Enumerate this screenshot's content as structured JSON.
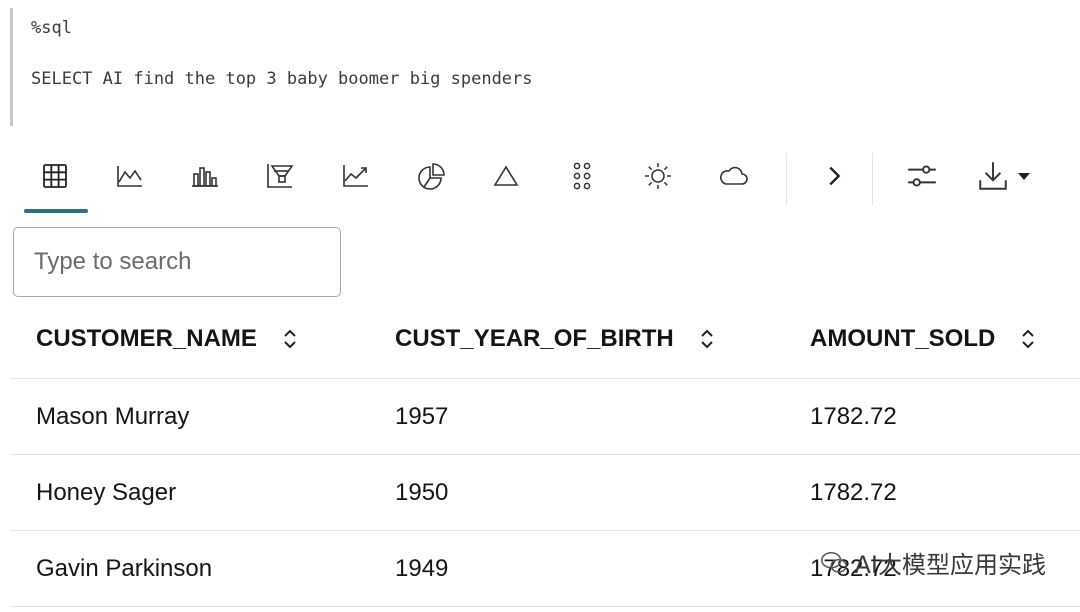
{
  "editor": {
    "line1": "%sql",
    "line2": "SELECT AI find the top 3 baby boomer big spenders"
  },
  "toolbar": {
    "buttons": [
      {
        "name": "table-icon"
      },
      {
        "name": "line-chart-icon"
      },
      {
        "name": "bar-chart-icon"
      },
      {
        "name": "funnel-chart-icon"
      },
      {
        "name": "area-chart-icon"
      },
      {
        "name": "pie-chart-icon"
      },
      {
        "name": "pyramid-icon"
      },
      {
        "name": "dot-grid-icon"
      },
      {
        "name": "sun-icon"
      },
      {
        "name": "cloud-icon"
      }
    ],
    "active_index": 0,
    "accent": "#2f6e88"
  },
  "search": {
    "placeholder": "Type to search"
  },
  "table": {
    "headers": [
      "CUSTOMER_NAME",
      "CUST_YEAR_OF_BIRTH",
      "AMOUNT_SOLD"
    ],
    "rows": [
      [
        "Mason Murray",
        "1957",
        "1782.72"
      ],
      [
        "Honey Sager",
        "1950",
        "1782.72"
      ],
      [
        "Gavin Parkinson",
        "1949",
        "1782.72"
      ]
    ]
  },
  "watermark": {
    "text": "AI大模型应用实践"
  }
}
